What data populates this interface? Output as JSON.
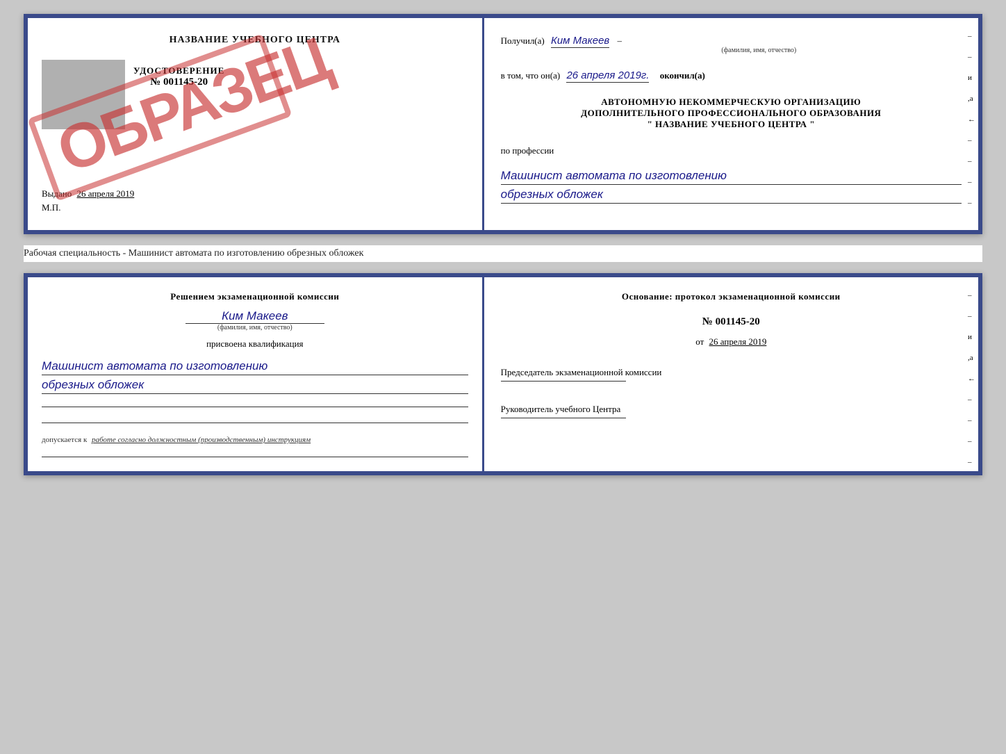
{
  "top_doc": {
    "left": {
      "title": "НАЗВАНИЕ УЧЕБНОГО ЦЕНТРА",
      "udost_label": "УДОСТОВЕРЕНИЕ",
      "udost_number": "№ 001145-20",
      "stamp_text": "ОБРАЗЕЦ",
      "vydano_prefix": "Выдано",
      "vydano_date": "26 апреля 2019",
      "mp_label": "М.П."
    },
    "right": {
      "poluchil_prefix": "Получил(а)",
      "poluchil_name": "Ким Макеев",
      "fio_label": "(фамилия, имя, отчество)",
      "vtom_prefix": "в том, что он(а)",
      "vtom_date": "26 апреля 2019г.",
      "vtom_suffix": "окончил(а)",
      "org_line1": "АВТОНОМНУЮ НЕКОММЕРЧЕСКУЮ ОРГАНИЗАЦИЮ",
      "org_line2": "ДОПОЛНИТЕЛЬНОГО ПРОФЕССИОНАЛЬНОГО ОБРАЗОВАНИЯ",
      "org_line3": "\"  НАЗВАНИЕ УЧЕБНОГО ЦЕНТРА  \"",
      "po_professii": "по профессии",
      "profession_line1": "Машинист автомата по изготовлению",
      "profession_line2": "обрезных обложек"
    }
  },
  "separator": {
    "text": "Рабочая специальность - Машинист автомата по изготовлению обрезных обложек"
  },
  "bottom_doc": {
    "left": {
      "resheniem_prefix": "Решением экзаменационной комиссии",
      "person_name": "Ким Макеев",
      "fio_label": "(фамилия, имя, отчество)",
      "prisvoena": "присвоена квалификация",
      "qualification_line1": "Машинист автомата по изготовлению",
      "qualification_line2": "обрезных обложек",
      "dopusk_prefix": "допускается к",
      "dopusk_text": "работе согласно должностным (производственным) инструкциям"
    },
    "right": {
      "osnovanie": "Основание: протокол экзаменационной комиссии",
      "number": "№ 001145-20",
      "ot_prefix": "от",
      "ot_date": "26 апреля 2019",
      "predsedatel_label": "Председатель экзаменационной комиссии",
      "rukovoditel_label": "Руководитель учебного Центра"
    }
  },
  "side_chars": [
    "–",
    "–",
    "и",
    "а",
    "←",
    "–",
    "–",
    "–",
    "–"
  ]
}
